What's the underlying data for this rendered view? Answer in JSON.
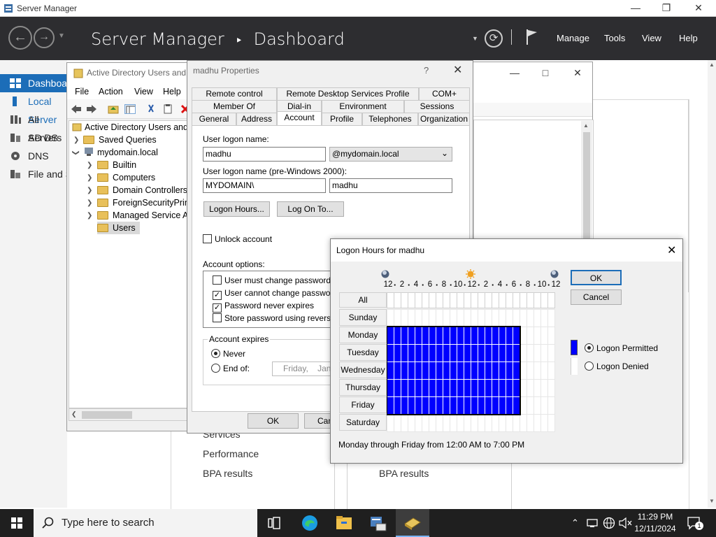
{
  "server_manager": {
    "window_title": "Server Manager",
    "header_title": "Server Manager",
    "header_sep": "‣",
    "header_page": "Dashboard",
    "menu": [
      "Manage",
      "Tools",
      "View",
      "Help"
    ],
    "nav": [
      "Dashboard",
      "Local Server",
      "All Servers",
      "AD DS",
      "DNS",
      "File and Storage Services"
    ],
    "tile_left": [
      "Services",
      "Performance",
      "BPA results"
    ],
    "tile_right": [
      "BPA results"
    ]
  },
  "aduc": {
    "title": "Active Directory Users and Computers",
    "menu": [
      "File",
      "Action",
      "View",
      "Help"
    ],
    "tree": {
      "root": "Active Directory Users and Computers",
      "saved_queries": "Saved Queries",
      "domain": "mydomain.local",
      "children": [
        "Builtin",
        "Computers",
        "Domain Controllers",
        "ForeignSecurityPrincipals",
        "Managed Service Accounts",
        "Users"
      ]
    }
  },
  "props": {
    "title": "madhu Properties",
    "help": "?",
    "tabs_row1": [
      "Remote control",
      "Remote Desktop Services Profile",
      "COM+"
    ],
    "tabs_row2": [
      "Member Of",
      "Dial-in",
      "Environment",
      "Sessions"
    ],
    "tabs_row3": [
      "General",
      "Address",
      "Account",
      "Profile",
      "Telephones",
      "Organization"
    ],
    "logon_name_label": "User logon name:",
    "logon_name": "madhu",
    "upn_suffix": "@mydomain.local",
    "pre2000_label": "User logon name (pre-Windows 2000):",
    "pre2000_domain": "MYDOMAIN\\",
    "pre2000_name": "madhu",
    "logon_hours_btn": "Logon Hours...",
    "logon_to_btn": "Log On To...",
    "unlock": "Unlock account",
    "options_label": "Account options:",
    "options": [
      {
        "label": "User must change password at next logon",
        "checked": false
      },
      {
        "label": "User cannot change password",
        "checked": true
      },
      {
        "label": "Password never expires",
        "checked": true
      },
      {
        "label": "Store password using reversible encryption",
        "checked": false
      }
    ],
    "expires_label": "Account expires",
    "never": "Never",
    "end_of": "End of:",
    "end_date_day": "Friday",
    "end_date_rest": ",    Jan",
    "ok": "OK",
    "cancel": "Cancel"
  },
  "logon_hours": {
    "title": "Logon Hours for madhu",
    "ticks": [
      "12",
      "2",
      "4",
      "6",
      "8",
      "10",
      "12",
      "2",
      "4",
      "6",
      "8",
      "10",
      "12"
    ],
    "all": "All",
    "days": [
      "Sunday",
      "Monday",
      "Tuesday",
      "Wednesday",
      "Thursday",
      "Friday",
      "Saturday"
    ],
    "permitted": [
      [],
      [
        0,
        19
      ],
      [
        0,
        19
      ],
      [
        0,
        19
      ],
      [
        0,
        19
      ],
      [
        0,
        19
      ],
      []
    ],
    "ok": "OK",
    "cancel": "Cancel",
    "legend_permitted": "Logon Permitted",
    "legend_denied": "Logon Denied",
    "summary": "Monday through Friday from 12:00 AM to 7:00 PM",
    "permitted_color": "#0000ff"
  },
  "taskbar": {
    "search_placeholder": "Type here to search",
    "time": "11:29 PM",
    "date": "12/11/2024",
    "notification_count": "1"
  }
}
